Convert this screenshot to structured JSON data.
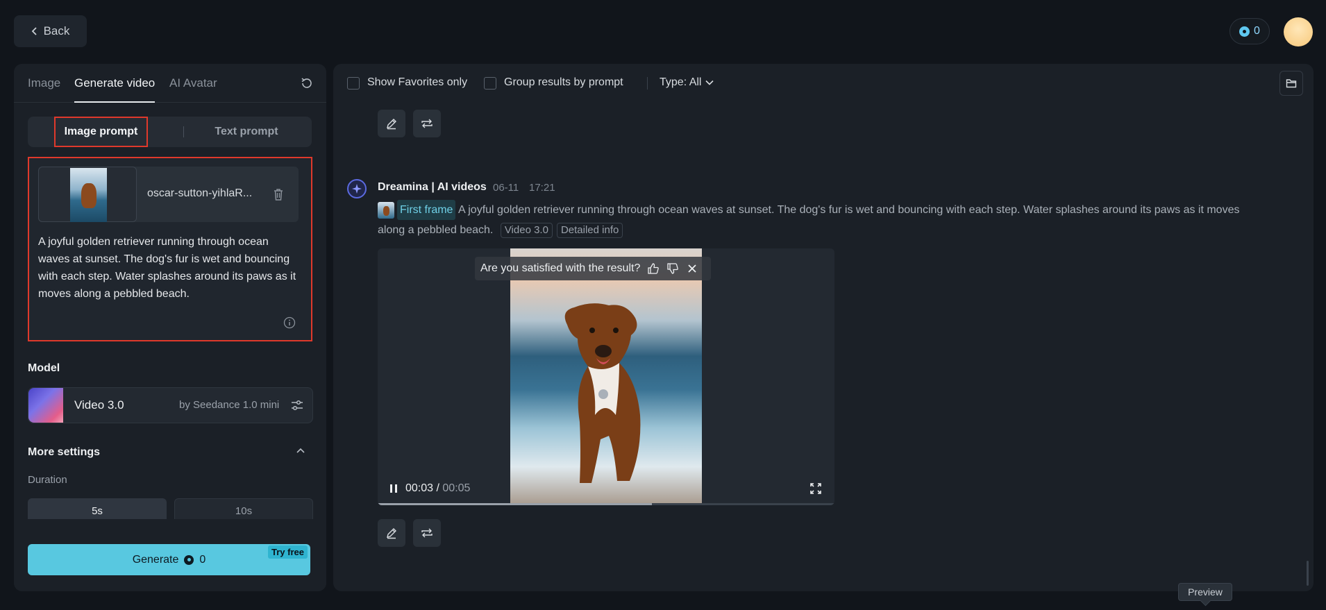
{
  "topbar": {
    "back_label": "Back",
    "credits": "0"
  },
  "left": {
    "tabs": [
      "Image",
      "Generate video",
      "AI Avatar"
    ],
    "prompt_toggle": {
      "image_prompt": "Image prompt",
      "text_prompt": "Text prompt"
    },
    "file_name": "oscar-sutton-yihlaR...",
    "prompt_text": "A joyful golden retriever running through ocean waves at sunset. The dog's fur is wet and bouncing with each step. Water splashes around its paws as it moves along a pebbled beach.",
    "model_label": "Model",
    "model_name": "Video 3.0",
    "model_by": "by Seedance 1.0 mini",
    "more_settings": "More settings",
    "duration_label": "Duration",
    "durations": [
      "5s",
      "10s"
    ],
    "generate_label": "Generate",
    "generate_cost": "0",
    "try_free": "Try free"
  },
  "right": {
    "filters": {
      "favorites": "Show Favorites only",
      "group": "Group results by prompt",
      "type": "Type: All"
    },
    "message": {
      "author": "Dreamina | AI videos",
      "date": "06-11",
      "time": "17:21",
      "first_frame": "First frame",
      "prompt": "A joyful golden retriever running through ocean waves at sunset. The dog's fur is wet and bouncing with each step. Water splashes around its paws as it moves along a pebbled beach.",
      "tag_model": "Video 3.0",
      "tag_info": "Detailed info"
    },
    "video": {
      "feedback": "Are you satisfied with the result?",
      "current": "00:03",
      "sep": "/",
      "total": "00:05",
      "progress": 0.6
    },
    "preview_tip": "Preview"
  },
  "colors": {
    "accent": "#58c8e0",
    "highlight": "#e0392b",
    "background": "#11151b"
  }
}
